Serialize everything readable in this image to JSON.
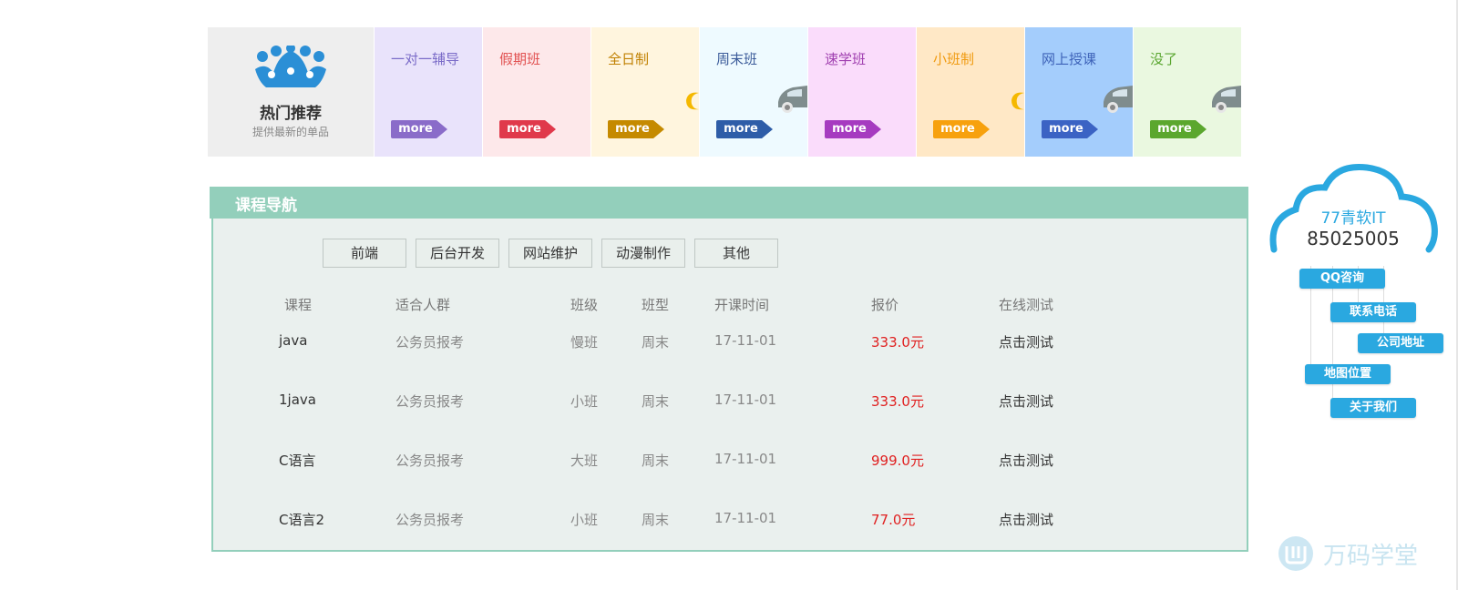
{
  "hot": {
    "title": "热门推荐",
    "subtitle": "提供最新的单品",
    "icon": "crown-icon",
    "more_label": "more",
    "cards": [
      {
        "label": "一对一辅导",
        "bg": "#e9e3fb",
        "label_color": "#7a6bc8",
        "btn_color": "#8a6cc9",
        "deco": "none"
      },
      {
        "label": "假期班",
        "bg": "#fde8ea",
        "label_color": "#e15050",
        "btn_color": "#e0394b",
        "deco": "none"
      },
      {
        "label": "全日制",
        "bg": "#fff5de",
        "label_color": "#c08000",
        "btn_color": "#c58a00",
        "deco": "moon"
      },
      {
        "label": "周末班",
        "bg": "#eefaff",
        "label_color": "#3b5b9a",
        "btn_color": "#2e5da8",
        "deco": "car"
      },
      {
        "label": "速学班",
        "bg": "#fadcfb",
        "label_color": "#a040b0",
        "btn_color": "#a63bc0",
        "deco": "none"
      },
      {
        "label": "小班制",
        "bg": "#ffe8c6",
        "label_color": "#f09a10",
        "btn_color": "#f7a10e",
        "deco": "moon"
      },
      {
        "label": "网上授课",
        "bg": "#a4cdfc",
        "label_color": "#3d62b8",
        "btn_color": "#3b63c4",
        "deco": "car"
      },
      {
        "label": "没了",
        "bg": "#eaf8e0",
        "label_color": "#5aa630",
        "btn_color": "#5ba72e",
        "deco": "car"
      }
    ]
  },
  "course_nav": {
    "title": "课程导航",
    "tabs": [
      "前端",
      "后台开发",
      "网站维护",
      "动漫制作",
      "其他"
    ],
    "columns": [
      "课程",
      "适合人群",
      "班级",
      "班型",
      "开课时间",
      "报价",
      "在线测试"
    ],
    "rows": [
      {
        "course": "java",
        "crowd": "公务员报考",
        "level": "慢班",
        "type": "周末",
        "date": "17-11-01",
        "price": "333.0元",
        "test": "点击测试"
      },
      {
        "course": "1java",
        "crowd": "公务员报考",
        "level": "小班",
        "type": "周末",
        "date": "17-11-01",
        "price": "333.0元",
        "test": "点击测试"
      },
      {
        "course": "C语言",
        "crowd": "公务员报考",
        "level": "大班",
        "type": "周末",
        "date": "17-11-01",
        "price": "999.0元",
        "test": "点击测试"
      },
      {
        "course": "C语言2",
        "crowd": "公务员报考",
        "level": "小班",
        "type": "周末",
        "date": "17-11-01",
        "price": "77.0元",
        "test": "点击测试"
      }
    ]
  },
  "sidebar": {
    "company": "77青软IT",
    "phone": "85025005",
    "buttons": [
      "QQ咨询",
      "联系电话",
      "公司地址",
      "地图位置",
      "关于我们"
    ],
    "accent": "#2aa8e0"
  },
  "brand": {
    "text": "万码学堂",
    "icon": "wm-logo-icon"
  }
}
